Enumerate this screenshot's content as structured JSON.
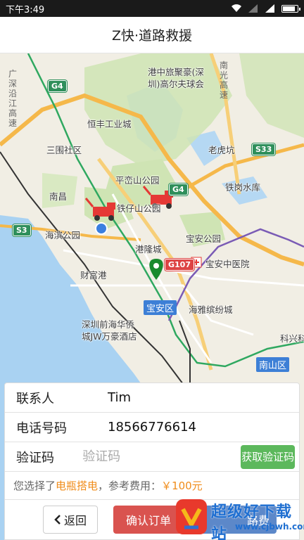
{
  "status_bar": {
    "time": "下午3:49"
  },
  "header": {
    "title": "Z快·道路救援"
  },
  "map": {
    "labels": [
      {
        "text": "港中旅聚豪(深"
      },
      {
        "text": "圳)高尔夫球会"
      },
      {
        "text": "恒丰工业城"
      },
      {
        "text": "三围社区"
      },
      {
        "text": "老虎坑"
      },
      {
        "text": "平峦山公园"
      },
      {
        "text": "铁岗水库"
      },
      {
        "text": "南昌"
      },
      {
        "text": "铁仔山公园"
      },
      {
        "text": "海滨公园"
      },
      {
        "text": "宝安公园"
      },
      {
        "text": "港隆城"
      },
      {
        "text": "宝安中医院"
      },
      {
        "text": "财富港"
      },
      {
        "text": "海雅缤纷城"
      },
      {
        "text": "深圳前海华侨"
      },
      {
        "text": "城JW万豪酒店"
      },
      {
        "text": "科兴科"
      }
    ],
    "vertical_labels": [
      "广深沿江高速",
      "南光高速"
    ],
    "road_badges": [
      "G4",
      "G4",
      "S33",
      "S3",
      "G107"
    ],
    "districts": [
      "宝安区",
      "南山区"
    ],
    "colors": {
      "water": "#a8d0f0",
      "park": "#cfe5b2",
      "highway": "#f5c05a",
      "metro_green": "#2fa860",
      "metro_purple": "#7a5bb5"
    }
  },
  "form": {
    "contact_label": "联系人",
    "contact_value": "Tim",
    "phone_label": "电话号码",
    "phone_value": "18566776614",
    "code_label": "验证码",
    "code_placeholder": "验证码",
    "get_code_button": "获取验证码",
    "summary_prefix": "您选择了",
    "service": "电瓶搭电",
    "summary_mid": "，参考费用：",
    "price": "￥100元"
  },
  "actions": {
    "back_label": "返回",
    "confirm_label": "确认订单",
    "other_label": "路费"
  },
  "watermark": {
    "text": "超级好下载站",
    "url": "www.cjbwh.com"
  }
}
